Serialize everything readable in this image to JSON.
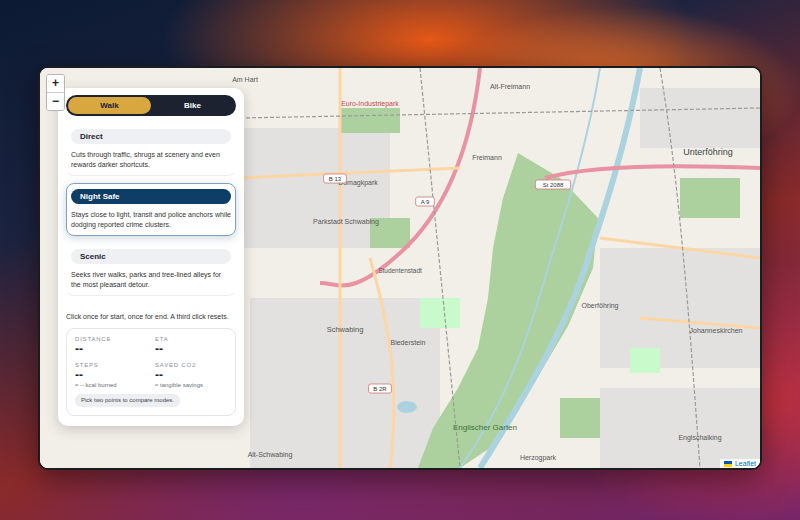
{
  "map": {
    "zoom_in": "+",
    "zoom_out": "−",
    "attribution": "Leaflet",
    "labels": [
      {
        "text": "Am Hart"
      },
      {
        "text": "Euro-Industriepark"
      },
      {
        "text": "Alt-Freimann"
      },
      {
        "text": "Unterföhring"
      },
      {
        "text": "Domagkpark"
      },
      {
        "text": "Freimann"
      },
      {
        "text": "Parkstadt Schwabing"
      },
      {
        "text": "Studentenstadt"
      },
      {
        "text": "Biederstein"
      },
      {
        "text": "Schwabing"
      },
      {
        "text": "Oberföhring"
      },
      {
        "text": "Johanneskirchen"
      },
      {
        "text": "Englischer Garten"
      },
      {
        "text": "Herzogpark"
      },
      {
        "text": "Alt-Schwabing"
      },
      {
        "text": "Englschalking"
      }
    ],
    "shields": [
      {
        "text": "B 13"
      },
      {
        "text": "A 9"
      },
      {
        "text": "St 2088"
      },
      {
        "text": "B 2R"
      }
    ]
  },
  "modes": [
    {
      "label": "Walk",
      "selected": true
    },
    {
      "label": "Bike",
      "selected": false
    }
  ],
  "routes": [
    {
      "title": "Direct",
      "description": "Cuts through traffic, shrugs at scenery and even rewards darker shortcuts.",
      "selected": false
    },
    {
      "title": "Night Safe",
      "description": "Stays close to light, transit and police anchors while dodging reported crime clusters.",
      "selected": true
    },
    {
      "title": "Scenic",
      "description": "Seeks river walks, parks and tree-lined alleys for the most pleasant detour.",
      "selected": false
    }
  ],
  "instruction": "Click once for start, once for end. A third click resets.",
  "stats": [
    {
      "label": "DISTANCE",
      "value": "--"
    },
    {
      "label": "ETA",
      "value": "--"
    },
    {
      "label": "STEPS",
      "value": "--",
      "note": "≈ -- kcal burned"
    },
    {
      "label": "SAVED CO2",
      "value": "--",
      "note": "≈ tangible savings"
    }
  ],
  "hint": "Pick two points to compare modes."
}
